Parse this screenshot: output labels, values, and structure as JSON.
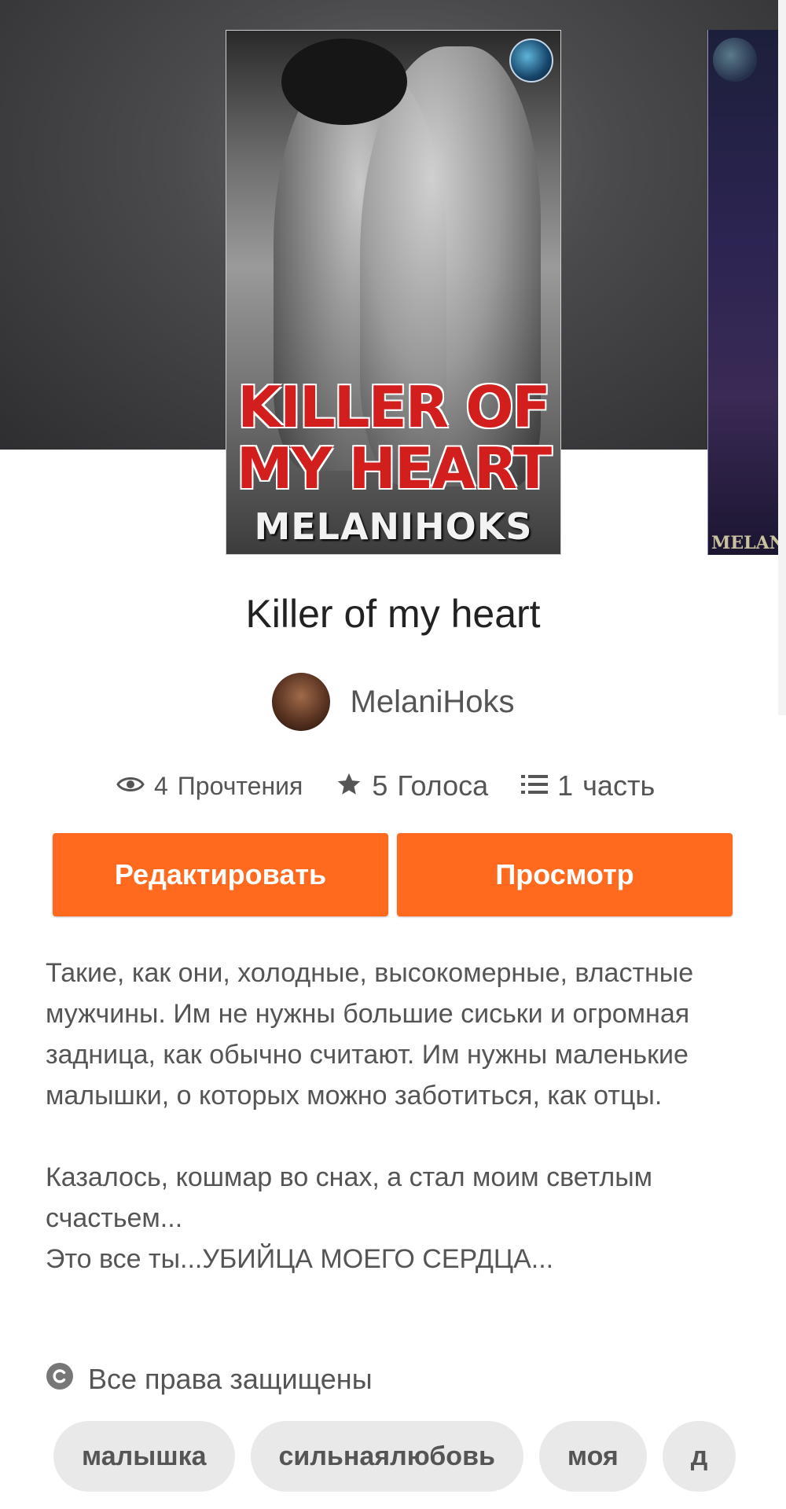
{
  "cover": {
    "title_line1": "KILLER OF",
    "title_line2": "MY HEART",
    "author": "MELANIHOKS"
  },
  "side_cover": {
    "author_fragment": "MELAN"
  },
  "story": {
    "title": "Killer of my heart",
    "author": "MelaniHoks"
  },
  "stats": {
    "reads": {
      "value": "4",
      "label": "Прочтения",
      "icon": "eye-icon"
    },
    "votes": {
      "value": "5",
      "label": "Голоса",
      "icon": "star-icon"
    },
    "parts": {
      "value": "1",
      "label": "часть",
      "icon": "list-icon"
    }
  },
  "buttons": {
    "edit_label": "Редактировать",
    "view_label": "Просмотр"
  },
  "description": "Такие, как они, холодные, высокомерные, властные мужчины. Им не нужны большие сиськи и огромная задница, как обычно считают. Им нужны маленькие малышки, о которых можно заботиться, как отцы.\n\nКазалось, кошмар во снах, а стал моим светлым счастьем...\nЭто все ты...УБИЙЦА МОЕГО СЕРДЦА...",
  "copyright": {
    "label": "Все права защищены",
    "icon": "copyright-icon"
  },
  "tags": [
    "малышка",
    "сильнаялюбовь",
    "моя",
    "д"
  ],
  "colors": {
    "accent": "#ff6a1f",
    "tag_bg": "#e9e9e9",
    "text_muted": "#555555"
  }
}
